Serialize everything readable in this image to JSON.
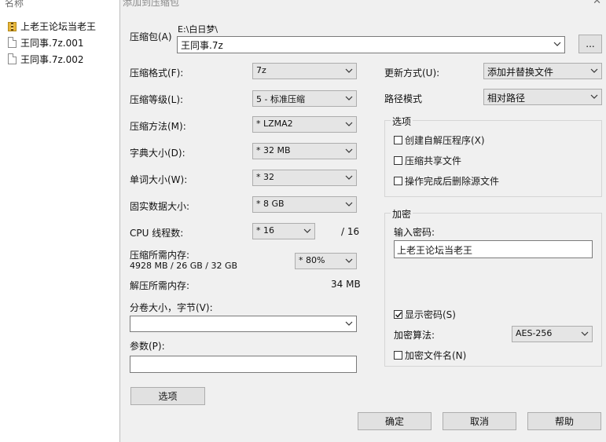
{
  "explorer": {
    "column_header": "名称",
    "items": [
      {
        "label": "上老王论坛当老王",
        "icon": "zip-folder-icon"
      },
      {
        "label": "王同事.7z.001",
        "icon": "file-icon"
      },
      {
        "label": "王同事.7z.002",
        "icon": "file-icon"
      }
    ]
  },
  "dialog": {
    "title": "添加到压缩包",
    "archive_label": "压缩包(A)",
    "archive_dir": "E:\\白日梦\\",
    "archive_name": "王同事.7z",
    "browse_label": "...",
    "left": {
      "format": {
        "label": "压缩格式(F):",
        "value": "7z"
      },
      "level": {
        "label": "压缩等级(L):",
        "value": "5 - 标准压缩"
      },
      "method": {
        "label": "压缩方法(M):",
        "value": "* LZMA2"
      },
      "dict": {
        "label": "字典大小(D):",
        "value": "* 32 MB"
      },
      "word": {
        "label": "单词大小(W):",
        "value": "* 32"
      },
      "solid": {
        "label": "固实数据大小:",
        "value": "* 8 GB"
      },
      "threads": {
        "label": "CPU 线程数:",
        "value": "* 16",
        "total": "/ 16"
      },
      "mem_compress": {
        "label": "压缩所需内存:",
        "detail": "4928 MB / 26 GB / 32 GB",
        "value": "* 80%"
      },
      "mem_decompress": {
        "label": "解压所需内存:",
        "value": "34 MB"
      },
      "volume": {
        "label": "分卷大小，字节(V):",
        "value": ""
      },
      "params": {
        "label": "参数(P):",
        "value": ""
      },
      "options_button": "选项"
    },
    "right": {
      "update_mode": {
        "label": "更新方式(U):",
        "value": "添加并替换文件"
      },
      "path_mode": {
        "label": "路径模式",
        "value": "相对路径"
      },
      "options_group": {
        "title": "选项",
        "sfx": {
          "label": "创建自解压程序(X)",
          "checked": false
        },
        "shared": {
          "label": "压缩共享文件",
          "checked": false
        },
        "delete": {
          "label": "操作完成后删除源文件",
          "checked": false
        }
      },
      "encryption_group": {
        "title": "加密",
        "password_label": "输入密码:",
        "password_value": "上老王论坛当老王",
        "show_password": {
          "label": "显示密码(S)",
          "checked": true
        },
        "method_label": "加密算法:",
        "method_value": "AES-256",
        "encrypt_names": {
          "label": "加密文件名(N)",
          "checked": false
        }
      }
    },
    "buttons": {
      "ok": "确定",
      "cancel": "取消",
      "help": "帮助"
    }
  }
}
